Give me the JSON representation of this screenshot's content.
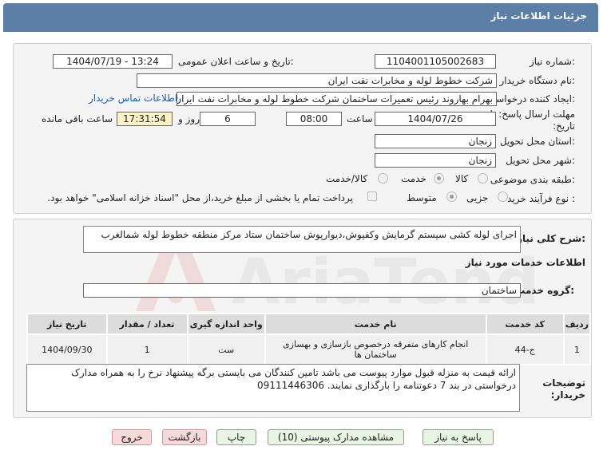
{
  "header": {
    "title": "جزئیات اطلاعات نیاز"
  },
  "labels": {
    "need_number": "شماره نیاز:",
    "announce_datetime": "تاریخ و ساعت اعلان عمومی:",
    "buyer_org": "نام دستگاه خریدار:",
    "requester": "ایجاد کننده درخواست:",
    "contact_link": "اطلاعات تماس خریدار",
    "deadline": "مهلت ارسال پاسخ: تا تاریخ:",
    "time_word": "ساعت",
    "day_and": "روز و",
    "remaining": "ساعت باقی مانده",
    "province": "استان محل تحویل:",
    "city": "شهر محل تحویل:",
    "category": "طبقه بندی موضوعی:",
    "purchase_type": "نوع فرآیند خرید :",
    "description_title": "شرح کلی نیاز:",
    "services_title": "اطلاعات خدمات مورد نیاز",
    "service_group": "گروه خدمت:",
    "buyer_notes": "توضیحات خریدار:"
  },
  "fields": {
    "need_number": "1104001105002683",
    "announce_datetime": "1404/07/19 - 13:24",
    "buyer_org": "شرکت خطوط لوله و مخابرات نفت ایران",
    "requester": "بهرام بهاروند رئیس تعمیرات ساختمان شرکت خطوط لوله و مخابرات نفت ایران",
    "deadline_date": "1404/07/26",
    "deadline_time": "08:00",
    "days": "6",
    "remaining_time": "17:31:54",
    "province": "زنجان",
    "city": "زنجان",
    "description": "اجرای لوله کشی سیستم گرمایش وکفپوش،دیوارپوش ساختمان ستاد مرکز منطقه خطوط لوله شمالغرب",
    "service_group": "ساختمان",
    "buyer_notes": "ارائه قیمت به منزله قبول موارد پیوست می باشد تامین کنندگان می بایستی برگه پیشنهاد نرخ را به همراه مدارک درخواستی در بند 7 دعوتنامه  را بارگذاری نمایند. 09111446306"
  },
  "category_options": {
    "goods": "کالا",
    "service": "خدمت",
    "goods_service": "کالا/خدمت"
  },
  "purchase_options": {
    "small": "جزیی",
    "medium": "متوسط",
    "treasury_note": "پرداخت تمام یا بخشی از مبلغ خرید،از محل \"اسناد خزانه اسلامی\" خواهد بود."
  },
  "table": {
    "headers": [
      "ردیف",
      "کد خدمت",
      "نام خدمت",
      "واحد اندازه گیری",
      "تعداد / مقدار",
      "تاریخ نیاز"
    ],
    "rows": [
      {
        "row": "1",
        "code": "ج-44",
        "name": "انجام کارهای متفرقه درخصوص بازسازی و بهسازی ساختمان ها",
        "unit": "ست",
        "qty": "1",
        "date": "1404/09/30"
      }
    ]
  },
  "buttons": {
    "reply": "پاسخ به نیاز",
    "attachments": "مشاهده مدارک پیوستی (10)",
    "print": "چاپ",
    "back": "بازگشت",
    "exit": "خروج"
  },
  "watermark": "AriaTender.net"
}
